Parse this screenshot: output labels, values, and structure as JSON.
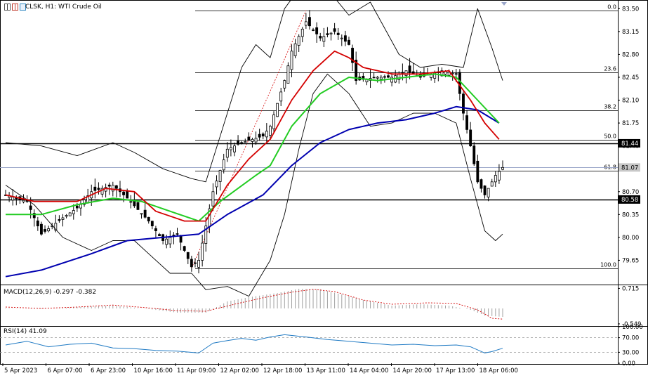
{
  "header": {
    "symbol_line": "CLSK, H1:  WTI Crude Oil",
    "macd_label": "MACD(12,26,9) -0.297 -0.382",
    "rsi_label": "RSI(14) 41.09"
  },
  "icons": [
    "bar-chart-icon",
    "candle-icon",
    "settings-icon"
  ],
  "colors": {
    "ma_red": "#d40000",
    "ma_green": "#22cc22",
    "ma_blue": "#0000b0",
    "bollinger": "#000000",
    "fib": "#7a7a7a",
    "macd_signal": "#d40000",
    "rsi": "#1f7ac4",
    "price_line": "#9aa6c9"
  },
  "chart_data": {
    "type": "candlestick",
    "main": {
      "ylim": [
        79.3,
        83.6
      ],
      "ticks": [
        "83.50",
        "83.15",
        "82.80",
        "82.45",
        "82.10",
        "81.75",
        "81.40",
        "81.07",
        "80.70",
        "80.35",
        "80.00",
        "79.65"
      ],
      "price_tags": [
        {
          "value": 81.44,
          "label": "81.44",
          "style": "dark"
        },
        {
          "value": 81.07,
          "label": "81.07",
          "style": "current"
        },
        {
          "value": 80.58,
          "label": "80.58",
          "style": "dark"
        }
      ],
      "hlines": [
        81.44,
        80.58
      ],
      "fibonacci": [
        {
          "level": "0.0",
          "price": 83.47
        },
        {
          "level": "23.6",
          "price": 82.53
        },
        {
          "level": "38.2",
          "price": 81.94
        },
        {
          "level": "50.0",
          "price": 81.49
        },
        {
          "level": "61.8",
          "price": 81.02
        },
        {
          "level": "100.0",
          "price": 79.53
        }
      ],
      "candle_count": 140,
      "price_path": [
        [
          0,
          80.65
        ],
        [
          6,
          80.55
        ],
        [
          10,
          80.05
        ],
        [
          16,
          80.3
        ],
        [
          20,
          80.45
        ],
        [
          24,
          80.7
        ],
        [
          30,
          80.8
        ],
        [
          34,
          80.6
        ],
        [
          40,
          80.25
        ],
        [
          44,
          79.95
        ],
        [
          48,
          80.05
        ],
        [
          52,
          79.55
        ],
        [
          54,
          79.65
        ],
        [
          58,
          80.7
        ],
        [
          62,
          81.35
        ],
        [
          66,
          81.45
        ],
        [
          72,
          81.55
        ],
        [
          74,
          81.7
        ],
        [
          78,
          82.4
        ],
        [
          80,
          82.85
        ],
        [
          84,
          83.3
        ],
        [
          88,
          83.05
        ],
        [
          92,
          83.15
        ],
        [
          96,
          82.95
        ],
        [
          98,
          82.4
        ],
        [
          104,
          82.45
        ],
        [
          108,
          82.45
        ],
        [
          112,
          82.55
        ],
        [
          116,
          82.45
        ],
        [
          122,
          82.55
        ],
        [
          126,
          82.5
        ],
        [
          128,
          81.9
        ],
        [
          130,
          81.4
        ],
        [
          132,
          80.85
        ],
        [
          134,
          80.65
        ],
        [
          137,
          80.95
        ],
        [
          139,
          81.07
        ]
      ],
      "indicators": {
        "red_ma": [
          [
            0,
            80.65
          ],
          [
            8,
            80.55
          ],
          [
            20,
            80.55
          ],
          [
            28,
            80.75
          ],
          [
            36,
            80.7
          ],
          [
            42,
            80.4
          ],
          [
            50,
            80.25
          ],
          [
            56,
            80.25
          ],
          [
            62,
            80.8
          ],
          [
            68,
            81.2
          ],
          [
            74,
            81.5
          ],
          [
            80,
            82.1
          ],
          [
            86,
            82.55
          ],
          [
            92,
            82.85
          ],
          [
            96,
            82.75
          ],
          [
            100,
            82.6
          ],
          [
            108,
            82.5
          ],
          [
            116,
            82.5
          ],
          [
            124,
            82.55
          ],
          [
            130,
            82.1
          ],
          [
            134,
            81.75
          ],
          [
            138,
            81.5
          ]
        ],
        "green_ma": [
          [
            0,
            80.35
          ],
          [
            10,
            80.35
          ],
          [
            20,
            80.5
          ],
          [
            30,
            80.6
          ],
          [
            38,
            80.55
          ],
          [
            46,
            80.4
          ],
          [
            54,
            80.25
          ],
          [
            60,
            80.55
          ],
          [
            70,
            80.95
          ],
          [
            74,
            81.1
          ],
          [
            80,
            81.7
          ],
          [
            88,
            82.2
          ],
          [
            96,
            82.45
          ],
          [
            104,
            82.4
          ],
          [
            112,
            82.45
          ],
          [
            120,
            82.5
          ],
          [
            126,
            82.45
          ],
          [
            132,
            82.1
          ],
          [
            138,
            81.75
          ]
        ],
        "blue_ma": [
          [
            0,
            79.4
          ],
          [
            10,
            79.5
          ],
          [
            24,
            79.75
          ],
          [
            34,
            79.95
          ],
          [
            44,
            80.0
          ],
          [
            54,
            80.05
          ],
          [
            62,
            80.35
          ],
          [
            72,
            80.65
          ],
          [
            80,
            81.1
          ],
          [
            88,
            81.45
          ],
          [
            96,
            81.65
          ],
          [
            104,
            81.75
          ],
          [
            112,
            81.8
          ],
          [
            120,
            81.9
          ],
          [
            126,
            82.0
          ],
          [
            132,
            81.95
          ],
          [
            138,
            81.75
          ]
        ],
        "bb_upper": [
          [
            0,
            81.45
          ],
          [
            10,
            81.4
          ],
          [
            20,
            81.25
          ],
          [
            30,
            81.45
          ],
          [
            36,
            81.3
          ],
          [
            44,
            81.05
          ],
          [
            52,
            80.9
          ],
          [
            56,
            80.85
          ],
          [
            60,
            81.55
          ],
          [
            66,
            82.6
          ],
          [
            70,
            82.95
          ],
          [
            74,
            82.75
          ],
          [
            78,
            83.5
          ],
          [
            84,
            83.95
          ],
          [
            90,
            83.8
          ],
          [
            96,
            83.4
          ],
          [
            102,
            83.6
          ],
          [
            110,
            82.8
          ],
          [
            116,
            82.6
          ],
          [
            122,
            82.65
          ],
          [
            128,
            82.6
          ],
          [
            132,
            83.5
          ],
          [
            136,
            82.9
          ],
          [
            139,
            82.4
          ]
        ],
        "bb_lower": [
          [
            0,
            80.8
          ],
          [
            8,
            80.5
          ],
          [
            16,
            80.0
          ],
          [
            24,
            79.8
          ],
          [
            30,
            79.95
          ],
          [
            36,
            79.95
          ],
          [
            40,
            79.75
          ],
          [
            46,
            79.45
          ],
          [
            52,
            79.45
          ],
          [
            56,
            79.2
          ],
          [
            62,
            79.25
          ],
          [
            68,
            79.1
          ],
          [
            74,
            79.65
          ],
          [
            78,
            80.35
          ],
          [
            82,
            81.35
          ],
          [
            86,
            82.2
          ],
          [
            90,
            82.5
          ],
          [
            96,
            82.2
          ],
          [
            102,
            81.7
          ],
          [
            108,
            81.75
          ],
          [
            114,
            81.9
          ],
          [
            120,
            81.9
          ],
          [
            126,
            81.75
          ],
          [
            130,
            80.9
          ],
          [
            134,
            80.1
          ],
          [
            137,
            79.95
          ],
          [
            139,
            80.05
          ]
        ]
      }
    },
    "macd": {
      "ylim": [
        -0.6,
        0.8
      ],
      "ticks": [
        "0.715",
        "-0.549"
      ],
      "signal_path": [
        [
          0,
          0.05
        ],
        [
          10,
          0.0
        ],
        [
          20,
          0.05
        ],
        [
          30,
          0.12
        ],
        [
          40,
          0.02
        ],
        [
          48,
          -0.08
        ],
        [
          56,
          -0.1
        ],
        [
          64,
          0.15
        ],
        [
          72,
          0.38
        ],
        [
          80,
          0.58
        ],
        [
          86,
          0.68
        ],
        [
          92,
          0.6
        ],
        [
          100,
          0.3
        ],
        [
          108,
          0.15
        ],
        [
          118,
          0.2
        ],
        [
          126,
          0.18
        ],
        [
          132,
          -0.05
        ],
        [
          136,
          -0.35
        ],
        [
          139,
          -0.38
        ]
      ],
      "histogram_path": [
        [
          0,
          0.02
        ],
        [
          10,
          -0.02
        ],
        [
          20,
          0.05
        ],
        [
          30,
          0.1
        ],
        [
          40,
          -0.02
        ],
        [
          48,
          -0.15
        ],
        [
          56,
          -0.15
        ],
        [
          62,
          0.25
        ],
        [
          68,
          0.4
        ],
        [
          76,
          0.55
        ],
        [
          82,
          0.7
        ],
        [
          88,
          0.68
        ],
        [
          94,
          0.5
        ],
        [
          100,
          0.3
        ],
        [
          108,
          0.1
        ],
        [
          116,
          0.15
        ],
        [
          124,
          0.1
        ],
        [
          130,
          -0.05
        ],
        [
          134,
          -0.25
        ],
        [
          139,
          -0.3
        ]
      ]
    },
    "rsi": {
      "ylim": [
        0,
        100
      ],
      "ticks": [
        "100.00",
        "70.00",
        "30.00",
        "0.00"
      ],
      "levels": [
        70,
        30
      ],
      "path": [
        [
          0,
          50
        ],
        [
          6,
          60
        ],
        [
          12,
          45
        ],
        [
          18,
          52
        ],
        [
          24,
          55
        ],
        [
          30,
          42
        ],
        [
          36,
          40
        ],
        [
          42,
          35
        ],
        [
          48,
          33
        ],
        [
          54,
          28
        ],
        [
          58,
          55
        ],
        [
          62,
          62
        ],
        [
          66,
          68
        ],
        [
          70,
          63
        ],
        [
          74,
          72
        ],
        [
          78,
          78
        ],
        [
          84,
          72
        ],
        [
          90,
          65
        ],
        [
          96,
          60
        ],
        [
          102,
          55
        ],
        [
          108,
          50
        ],
        [
          114,
          52
        ],
        [
          120,
          48
        ],
        [
          126,
          50
        ],
        [
          130,
          45
        ],
        [
          134,
          28
        ],
        [
          136,
          32
        ],
        [
          139,
          41
        ]
      ]
    },
    "x_tick_labels": [
      "5 Apr 2023",
      "6 Apr 07:00",
      "6 Apr 23:00",
      "10 Apr 16:00",
      "11 Apr 09:00",
      "12 Apr 02:00",
      "12 Apr 18:00",
      "13 Apr 11:00",
      "14 Apr 04:00",
      "14 Apr 20:00",
      "17 Apr 13:00",
      "18 Apr 06:00"
    ]
  }
}
